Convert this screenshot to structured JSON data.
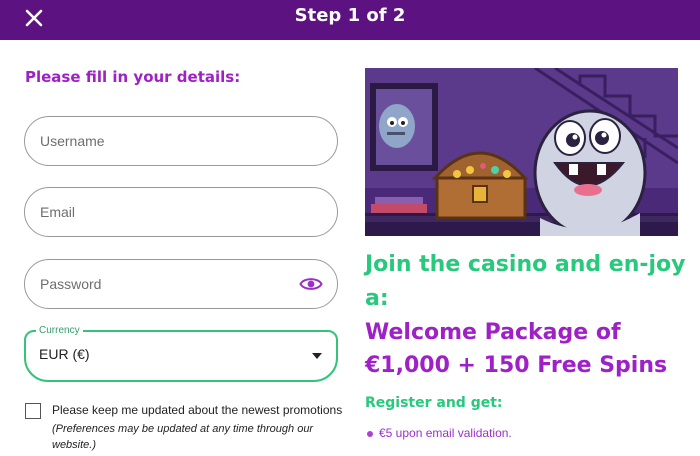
{
  "header": {
    "title": "Step 1 of 2",
    "close_icon": "close-icon"
  },
  "form": {
    "title": "Please fill in your details:",
    "username": {
      "placeholder": "Username",
      "value": ""
    },
    "email": {
      "placeholder": "Email",
      "value": ""
    },
    "password": {
      "placeholder": "Password",
      "value": "",
      "icon": "eye-icon"
    },
    "currency": {
      "label": "Currency",
      "selected": "EUR (€)"
    },
    "consent": {
      "checked": false,
      "label": "Please keep me updated about the newest promotions",
      "note": "(Preferences may be updated at any time through our website.)"
    }
  },
  "promo": {
    "line1": "Join the casino and en-joy a:",
    "line2": "Welcome Package of €1,000 + 150 Free Spins",
    "subtitle": "Register and get:",
    "bullets": [
      "€5 upon email validation."
    ]
  },
  "colors": {
    "header_bg": "#5c1280",
    "purple_accent": "#a020c8",
    "green_accent": "#27c97c",
    "currency_border": "#33c47a"
  }
}
